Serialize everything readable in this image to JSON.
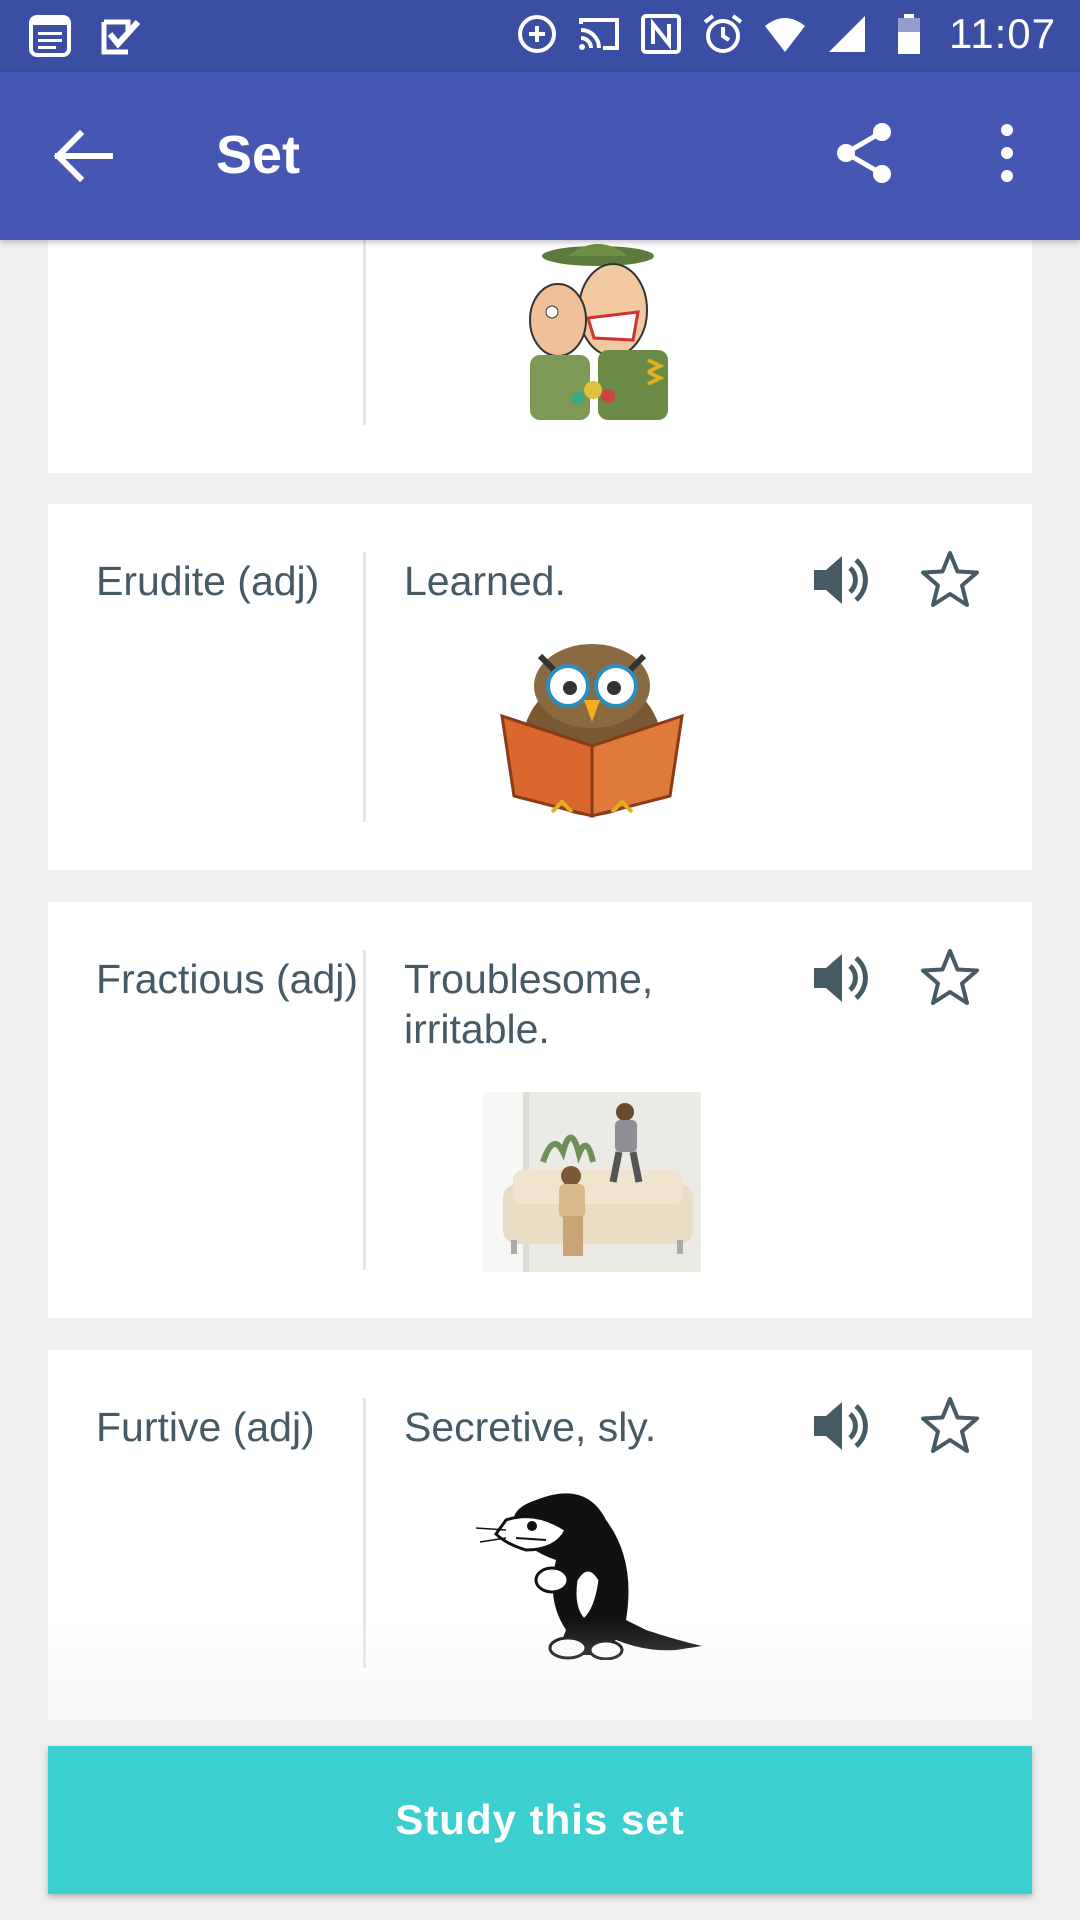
{
  "status_bar": {
    "time": "11:07",
    "icons": [
      "notification-list-icon",
      "checkbox-icon",
      "data-saver-icon",
      "cast-icon",
      "nfc-icon",
      "alarm-icon",
      "wifi-icon",
      "signal-icon",
      "battery-icon"
    ]
  },
  "app_bar": {
    "title": "Set",
    "icons": [
      "back-arrow-icon",
      "share-icon",
      "more-vert-icon"
    ],
    "color": "#4557b3"
  },
  "cards": [
    {
      "term": "",
      "definition": "",
      "image": "drill-sergeant-cartoon"
    },
    {
      "term": "Erudite (adj)",
      "definition": "Learned.",
      "image": "owl-reading-book"
    },
    {
      "term": "Fractious (adj)",
      "definition": "Troublesome, irritable.",
      "image": "child-jumping-on-couch-photo"
    },
    {
      "term": "Furtive (adj)",
      "definition": "Secretive, sly.",
      "image": "sneaky-cat-cartoon"
    }
  ],
  "study_button": {
    "label": "Study this set",
    "color": "#3ccfcf"
  }
}
